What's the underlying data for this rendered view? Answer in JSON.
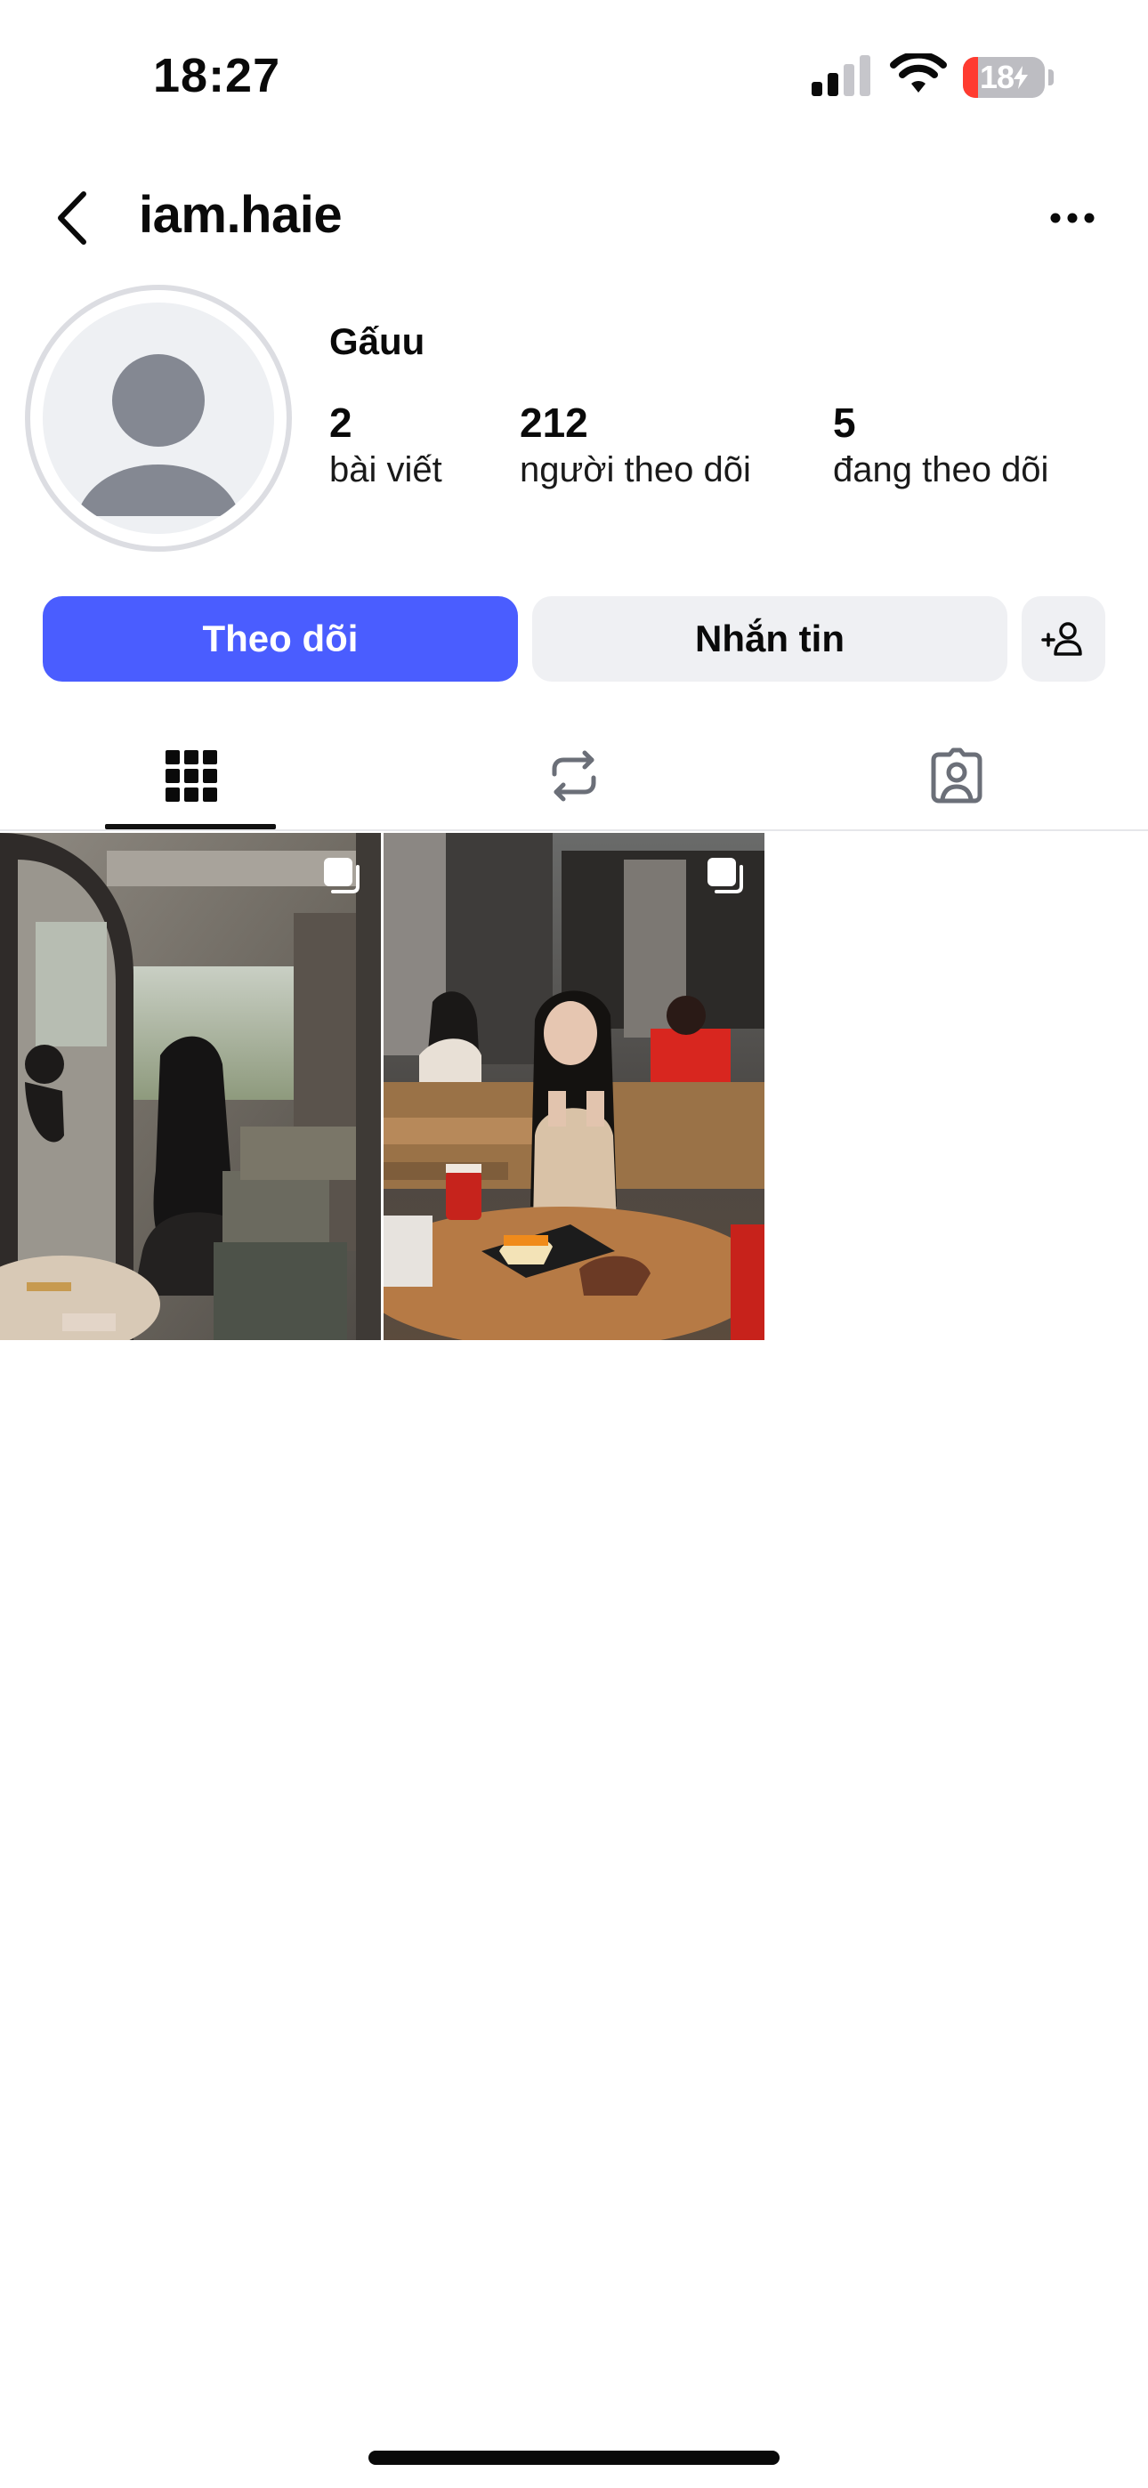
{
  "status_bar": {
    "time": "18:27",
    "battery_level": "18",
    "battery_fraction": 0.18,
    "battery_color": "#ff3b30"
  },
  "header": {
    "username": "iam.haie",
    "back_icon": "chevron-left-icon",
    "more_icon": "more-horizontal-icon"
  },
  "profile": {
    "display_name": "Gấuu",
    "stats": [
      {
        "value": "2",
        "label": "bài viết"
      },
      {
        "value": "212",
        "label": "người theo dõi"
      },
      {
        "value": "5",
        "label": "đang theo dõi"
      }
    ]
  },
  "actions": {
    "follow_label": "Theo dõi",
    "message_label": "Nhắn tin",
    "suggest_icon": "add-person-icon",
    "accent_color": "#4a5dff"
  },
  "tabs": [
    {
      "icon": "grid-icon",
      "active": true
    },
    {
      "icon": "repost-icon",
      "active": false
    },
    {
      "icon": "tagged-person-icon",
      "active": false
    }
  ],
  "posts": [
    {
      "type": "carousel",
      "icon": "multiple-photos-icon"
    },
    {
      "type": "carousel",
      "icon": "multiple-photos-icon"
    }
  ]
}
